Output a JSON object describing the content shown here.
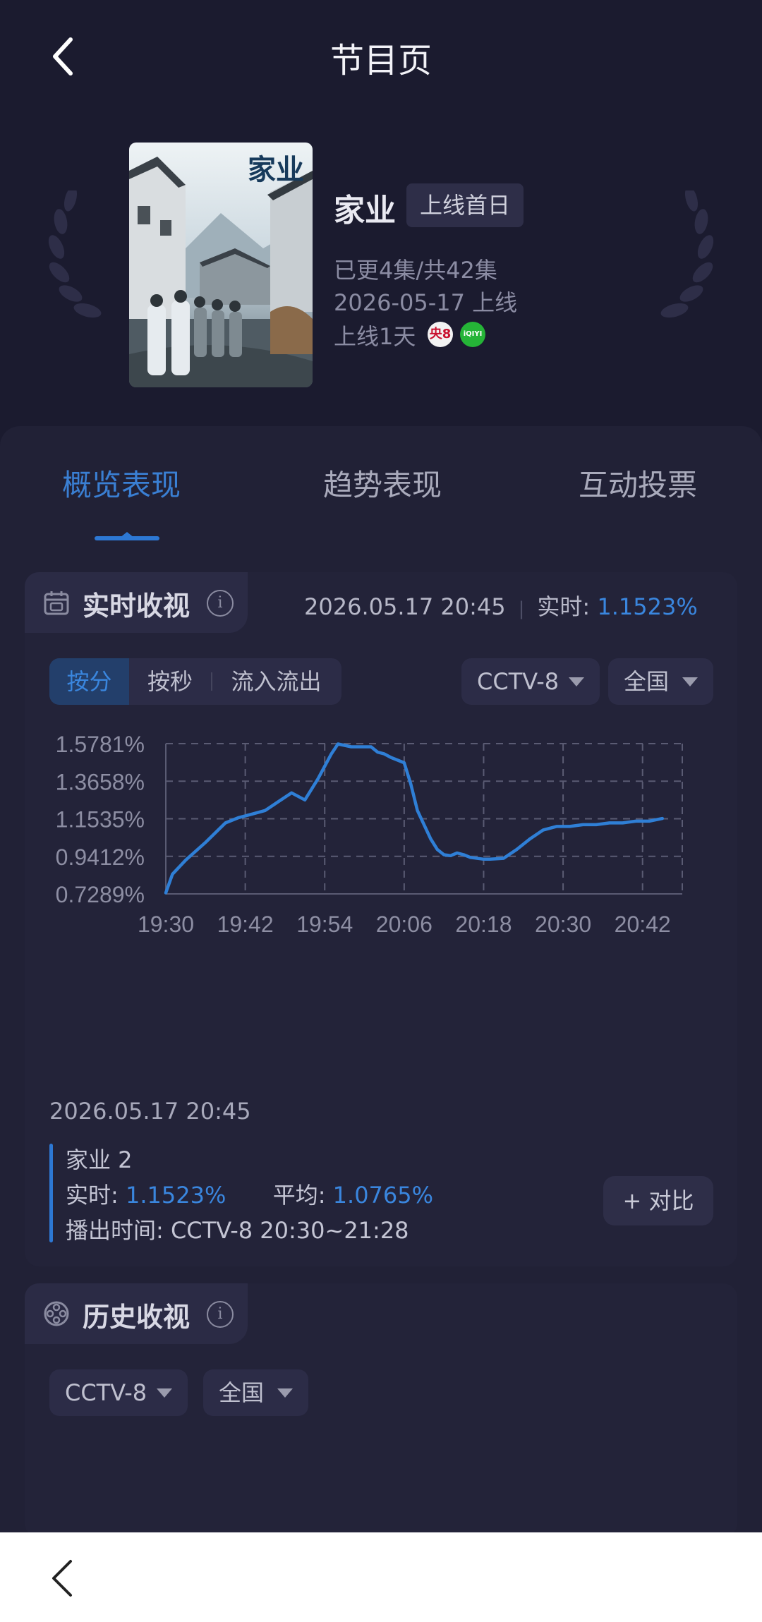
{
  "header": {
    "title": "节目页"
  },
  "show": {
    "poster_title": "家业",
    "name": "家业",
    "tag": "上线首日",
    "episodes": "已更4集/共42集",
    "release": "2026-05-17 上线",
    "days_online": "上线1天",
    "platform_icons": [
      {
        "name": "cctv8",
        "text": "央8"
      },
      {
        "name": "iqiyi",
        "text": "iQIYI"
      }
    ]
  },
  "tabs": [
    "概览表现",
    "趋势表现",
    "互动投票"
  ],
  "realtime": {
    "title": "实时收视",
    "timestamp": "2026.05.17 20:45",
    "rt_label": "实时:",
    "rt_value": "1.1523%",
    "modes": [
      "按分",
      "按秒",
      "流入流出"
    ],
    "channel": "CCTV-8",
    "region": "全国",
    "selected": {
      "date": "2026.05.17 20:45",
      "episode": "家业 2",
      "rt_label": "实时:",
      "rt_value": "1.1523%",
      "avg_label": "平均:",
      "avg_value": "1.0765%",
      "airtime": "播出时间:  CCTV-8 20:30~21:28"
    },
    "compare_label": "+ 对比"
  },
  "history": {
    "title": "历史收视",
    "channel": "CCTV-8",
    "region": "全国"
  },
  "chart_data": {
    "type": "line",
    "x_labels": [
      "19:30",
      "19:42",
      "19:54",
      "20:06",
      "20:18",
      "20:30",
      "20:42"
    ],
    "y_ticks": [
      "0.7289%",
      "0.9412%",
      "1.1535%",
      "1.3658%",
      "1.5781%"
    ],
    "ylim": [
      0.7289,
      1.5781
    ],
    "grid": true,
    "series": [
      {
        "color": "#2f7fd6",
        "x_minutes": [
          0,
          1,
          3,
          6,
          9,
          11,
          13,
          15,
          17,
          19,
          21,
          22,
          23,
          25,
          26,
          28,
          29,
          31,
          32,
          33,
          34,
          36,
          37,
          38,
          40,
          41,
          42,
          43,
          44,
          45,
          46,
          48,
          49,
          51,
          53,
          55,
          57,
          59,
          61,
          63,
          65,
          67,
          69,
          71,
          73,
          75
        ],
        "values": [
          0.735,
          0.84,
          0.92,
          1.02,
          1.13,
          1.16,
          1.18,
          1.2,
          1.25,
          1.3,
          1.26,
          1.32,
          1.38,
          1.52,
          1.576,
          1.56,
          1.56,
          1.56,
          1.53,
          1.52,
          1.5,
          1.47,
          1.35,
          1.2,
          1.04,
          0.98,
          0.95,
          0.945,
          0.96,
          0.95,
          0.935,
          0.925,
          0.925,
          0.93,
          0.98,
          1.04,
          1.09,
          1.11,
          1.11,
          1.12,
          1.12,
          1.13,
          1.13,
          1.14,
          1.14,
          1.155
        ]
      }
    ]
  }
}
